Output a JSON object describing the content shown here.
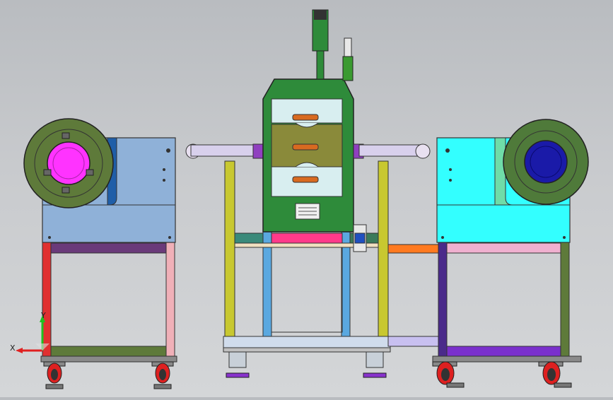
{
  "view": {
    "background_top": "#b9bcc0",
    "background_bottom": "#d4d6d8"
  },
  "triad": {
    "x_label": "X",
    "y_label": "Y",
    "x_color": "#e02020",
    "y_color": "#20c020"
  },
  "colors": {
    "left_cabinet": "#8fb1d8",
    "right_cabinet": "#33ffff",
    "center_body": "#2e8b3a",
    "left_disc": "#5e7a3a",
    "left_disc_hub": "#ff33ff",
    "right_disc": "#4f7a3a",
    "right_disc_hub": "#1a1aa8",
    "frame_left_red": "#e03030",
    "frame_pink": "#f0b0b8",
    "frame_purple": "#5a2e8a",
    "frame_olive": "#6a7a3a",
    "frame_yellow": "#d8d820",
    "frame_blue": "#4aa0e0",
    "frame_orange": "#ff7a20",
    "frame_magenta_bar": "#ff3a8a",
    "casters_purple": "#8833cc",
    "casters_red": "#dd2020"
  }
}
